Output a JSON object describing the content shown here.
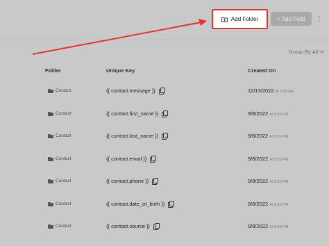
{
  "toolbar": {
    "add_folder_label": "Add Folder",
    "add_field_label": "+ Add Field",
    "more_glyph": "⋮"
  },
  "group_by": {
    "label": "Group By",
    "value": "All"
  },
  "table": {
    "columns": [
      "Folder",
      "Unique Key",
      "Created On"
    ],
    "rows": [
      {
        "folder": "Contact",
        "key": "{{ contact.message }}",
        "date": "12/13/2022",
        "time": "At 1:54 AM"
      },
      {
        "folder": "Contact",
        "key": "{{ contact.first_name }}",
        "date": "9/8/2022",
        "time": "At 5:50 PM"
      },
      {
        "folder": "Contact",
        "key": "{{ contact.last_name }}",
        "date": "9/8/2022",
        "time": "At 5:50 PM"
      },
      {
        "folder": "Contact",
        "key": "{{ contact.email }}",
        "date": "9/8/2022",
        "time": "At 5:50 PM"
      },
      {
        "folder": "Contact",
        "key": "{{ contact.phone }}",
        "date": "9/8/2022",
        "time": "At 5:50 PM"
      },
      {
        "folder": "Contact",
        "key": "{{ contact.date_of_birth }}",
        "date": "9/8/2022",
        "time": "At 5:50 PM"
      },
      {
        "folder": "Contact",
        "key": "{{ contact.source }}",
        "date": "9/8/2022",
        "time": "At 5:50 PM"
      }
    ]
  },
  "colors": {
    "highlight": "#e0362c",
    "background": "#c9c9c9"
  },
  "icons": {
    "folder": "folder-icon",
    "copy": "copy-icon",
    "add_folder": "folder-plus-icon",
    "dropdown": "chevron-down-icon"
  }
}
